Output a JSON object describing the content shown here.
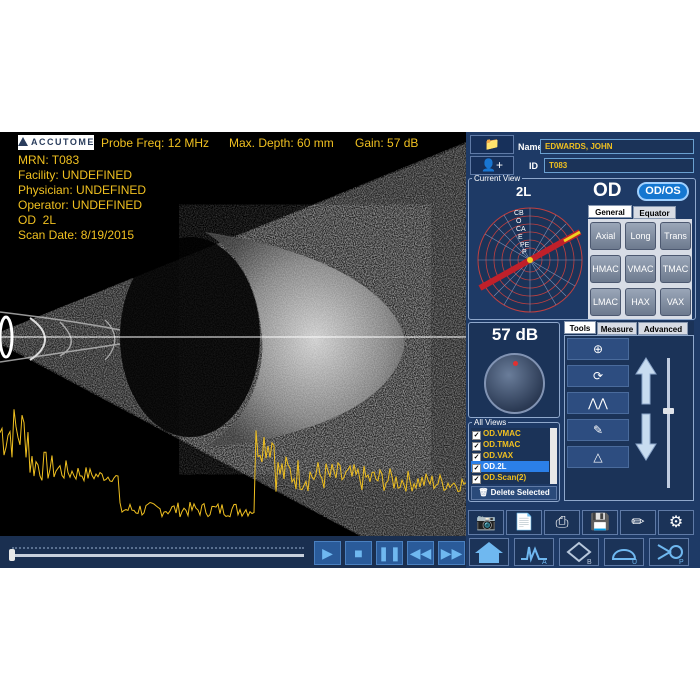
{
  "header": {
    "logo": "ACCUTOME",
    "probe_freq": "Probe Freq: 12 MHz",
    "max_depth": "Max. Depth: 60 mm",
    "gain": "Gain: 57 dB"
  },
  "scan_info": {
    "mrn": "MRN: T083",
    "facility": "Facility: UNDEFINED",
    "physician": "Physician: UNDEFINED",
    "operator": "Operator: UNDEFINED",
    "eye": "OD  2L",
    "scan_date": "Scan Date: 8/19/2015"
  },
  "playback": {
    "play_icon": "play-icon",
    "stop_icon": "stop-icon",
    "pause_icon": "pause-icon",
    "rewind_icon": "rewind-icon",
    "forward_icon": "fast-forward-icon",
    "position": 0
  },
  "patient": {
    "name_label": "Name",
    "name_value": "EDWARDS, JOHN",
    "id_label": "ID",
    "id_value": "T083"
  },
  "current_view": {
    "legend": "Current View",
    "probe_label": "2L",
    "eye": "OD",
    "odos_button": "OD/OS",
    "tabs": [
      "General",
      "Equator"
    ],
    "view_buttons": [
      "Axial",
      "Long",
      "Trans",
      "HMAC",
      "VMAC",
      "TMAC",
      "LMAC",
      "HAX",
      "VAX"
    ],
    "clock_labels": [
      "CB",
      "O",
      "CA",
      "E",
      "PE",
      "P"
    ]
  },
  "gain_control": {
    "value": "57 dB"
  },
  "tools": {
    "tabs": [
      "Tools",
      "Measure",
      "Advanced"
    ]
  },
  "all_views": {
    "legend": "All Views",
    "items": [
      "OD.VMAC",
      "OD.TMAC",
      "OD.VAX",
      "OD.2L",
      "OD.Scan(2)"
    ],
    "selected_index": 3,
    "delete_label": "Delete Selected"
  },
  "colors": {
    "accent_yellow": "#f0c020",
    "panel_blue": "#1e3a66",
    "highlight_blue": "#2b7fe8",
    "probe_red": "#c0202a"
  }
}
